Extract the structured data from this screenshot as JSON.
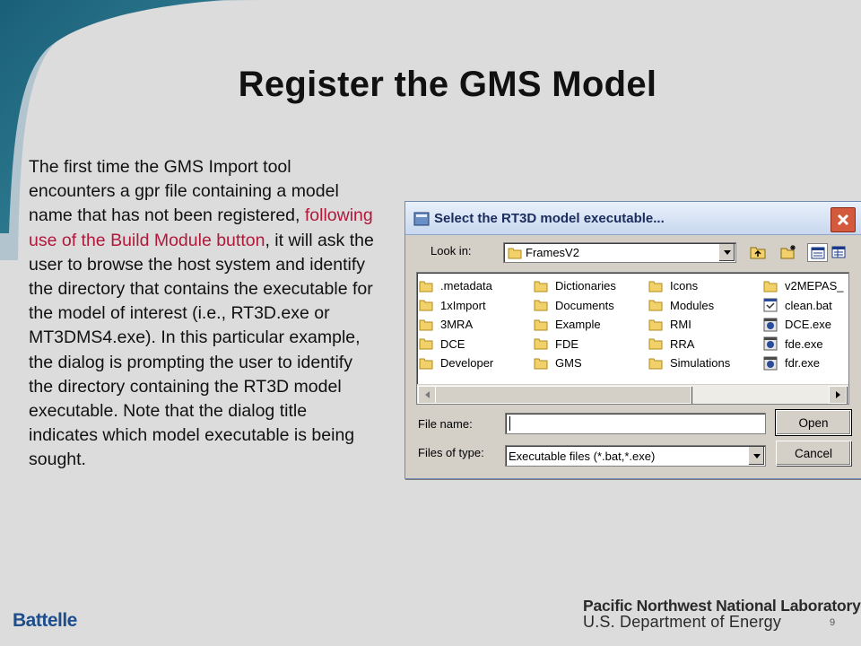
{
  "slide": {
    "title": "Register the GMS Model",
    "body_before": "The first time the GMS Import tool encounters a gpr file containing a model name that has not been registered, ",
    "body_highlight": "following use of the Build Module button",
    "body_after": ", it will ask the user to browse the host system and identify the directory that contains the executable for the model of interest (i.e., RT3D.exe or MT3DMS4.exe). In this particular example, the dialog is prompting the user to identify the directory containing the RT3D model executable.  Note that the dialog title indicates which model executable is being sought.",
    "highlight_color": "#b0193a",
    "page_number": "9"
  },
  "dialog": {
    "title": "Select the RT3D model executable...",
    "look_in_label": "Look in:",
    "look_in_value": "FramesV2",
    "columns": [
      [
        {
          "name": ".metadata",
          "icon": "folder-icon"
        },
        {
          "name": "1xImport",
          "icon": "folder-icon"
        },
        {
          "name": "3MRA",
          "icon": "folder-icon"
        },
        {
          "name": "DCE",
          "icon": "folder-icon"
        },
        {
          "name": "Developer",
          "icon": "folder-icon"
        }
      ],
      [
        {
          "name": "Dictionaries",
          "icon": "folder-icon"
        },
        {
          "name": "Documents",
          "icon": "folder-icon"
        },
        {
          "name": "Example",
          "icon": "folder-icon"
        },
        {
          "name": "FDE",
          "icon": "folder-icon"
        },
        {
          "name": "GMS",
          "icon": "folder-icon"
        }
      ],
      [
        {
          "name": "Icons",
          "icon": "folder-icon"
        },
        {
          "name": "Modules",
          "icon": "folder-icon"
        },
        {
          "name": "RMI",
          "icon": "folder-icon"
        },
        {
          "name": "RRA",
          "icon": "folder-icon"
        },
        {
          "name": "Simulations",
          "icon": "folder-icon"
        }
      ],
      [
        {
          "name": "v2MEPAS_",
          "icon": "folder-icon"
        },
        {
          "name": "clean.bat",
          "icon": "batch-file-icon"
        },
        {
          "name": "DCE.exe",
          "icon": "exe-file-icon"
        },
        {
          "name": "fde.exe",
          "icon": "exe-file-icon"
        },
        {
          "name": "fdr.exe",
          "icon": "exe-file-icon"
        }
      ]
    ],
    "file_name_label": "File name:",
    "file_name_value": "",
    "files_of_type_label": "Files of type:",
    "files_of_type_value": "Executable files (*.bat,*.exe)",
    "open_button": "Open",
    "cancel_button": "Cancel"
  },
  "footer": {
    "battelle": "Battelle",
    "pnnl": "Pacific Northwest National Laboratory",
    "doe": "U.S. Department of Energy"
  }
}
